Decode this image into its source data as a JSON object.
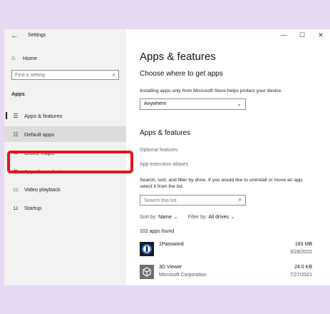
{
  "window": {
    "title": "Settings",
    "controls": [
      "minimize-icon",
      "maximize-icon",
      "close-icon"
    ]
  },
  "sidebar": {
    "home_label": "Home",
    "search_placeholder": "Find a setting",
    "section_label": "Apps",
    "items": [
      {
        "label": "Apps & features",
        "icon": "apps-features-icon"
      },
      {
        "label": "Default apps",
        "icon": "default-apps-icon",
        "selected": true
      },
      {
        "label": "Offline maps",
        "icon": "offline-maps-icon"
      },
      {
        "label": "Apps for websites",
        "icon": "apps-websites-icon"
      },
      {
        "label": "Video playback",
        "icon": "video-playback-icon"
      },
      {
        "label": "Startup",
        "icon": "startup-icon"
      }
    ]
  },
  "main": {
    "title": "Apps & features",
    "source_heading": "Choose where to get apps",
    "source_desc": "Installing apps only from Microsoft Store helps protect your device.",
    "source_value": "Anywhere",
    "apps_heading": "Apps & features",
    "optional_features": "Optional features",
    "execution_aliases": "App execution aliases",
    "search_desc": "Search, sort, and filter by drive. If you would like to uninstall or move an app, select it from the list.",
    "search_placeholder": "Search this list",
    "sort_label": "Sort by:",
    "sort_value": "Name",
    "filter_label": "Filter by:",
    "filter_value": "All drives",
    "count": "102 apps found",
    "apps": [
      {
        "name": "1Password",
        "publisher": "",
        "size": "183 MB",
        "date": "3/28/2022",
        "icon": "onepassword-icon"
      },
      {
        "name": "3D Viewer",
        "publisher": "Microsoft Corporation",
        "size": "24.0 KB",
        "date": "7/27/2021",
        "icon": "3d-viewer-icon"
      }
    ]
  },
  "colors": {
    "background": "#e6d9f3",
    "highlight": "#e8141a",
    "sidebar": "#f2f2f2",
    "selected": "#dcdcdc"
  }
}
